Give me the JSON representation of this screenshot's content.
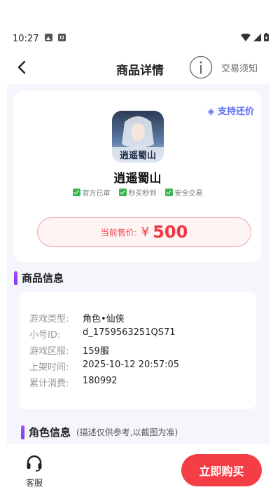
{
  "status_bar": {
    "time": "10:27"
  },
  "nav": {
    "title": "商品详情",
    "notice": "交易须知"
  },
  "product": {
    "support_tag": "◈ 支持还价",
    "icon_text": "逍遥蜀山",
    "name": "逍遥蜀山",
    "badges": [
      "官方已审",
      "秒买秒到",
      "安全交易"
    ],
    "price_label": "当前售价:",
    "price_currency": "¥",
    "price_value": "500"
  },
  "product_info": {
    "title": "商品信息",
    "rows": [
      {
        "label": "游戏类型:",
        "value": "角色•仙侠"
      },
      {
        "label": "小号ID:",
        "value": "d_1759563251QS71"
      },
      {
        "label": "游戏区服:",
        "value": "159服"
      },
      {
        "label": "上架时间:",
        "value": "2025-10-12 20:57:05"
      },
      {
        "label": "累计消费:",
        "value": "180992"
      }
    ]
  },
  "role_info": {
    "title": "角色信息",
    "note": "(描述仅供参考,以截图为准)"
  },
  "bottom": {
    "cs_label": "客服",
    "buy_label": "立即购买"
  },
  "colors": {
    "accent": "#f53d45",
    "purple": "#8a44ff",
    "blue_tag": "#5b6ef5"
  }
}
